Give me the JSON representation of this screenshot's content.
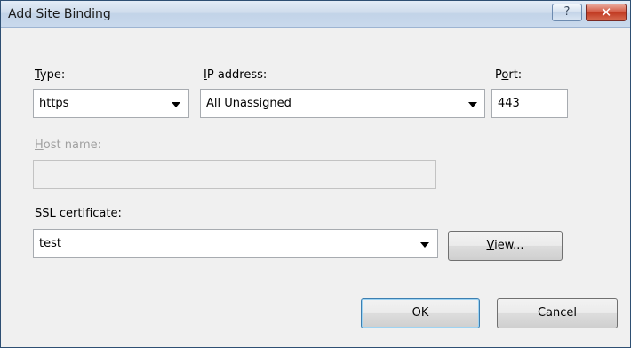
{
  "window": {
    "title": "Add Site Binding",
    "help_label": "?",
    "close_label": "✕"
  },
  "type": {
    "label_ul": "T",
    "label_rest": "ype:",
    "value": "https"
  },
  "ip": {
    "label_ul": "I",
    "label_rest": "P address:",
    "value": "All Unassigned"
  },
  "port": {
    "label_pre": "P",
    "label_ul": "o",
    "label_rest": "rt:",
    "value": "443"
  },
  "host": {
    "label_ul": "H",
    "label_rest": "ost name:",
    "value": ""
  },
  "ssl": {
    "label_ul": "S",
    "label_rest": "SL certificate:",
    "value": "test"
  },
  "buttons": {
    "view_ul": "V",
    "view_rest": "iew...",
    "ok": "OK",
    "cancel": "Cancel"
  },
  "icons": {
    "dropdown": "chevron-down-icon"
  }
}
